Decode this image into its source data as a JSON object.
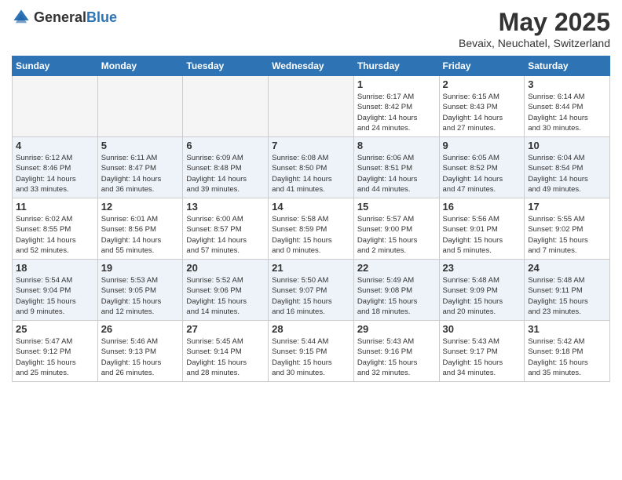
{
  "logo": {
    "general": "General",
    "blue": "Blue"
  },
  "title": "May 2025",
  "location": "Bevaix, Neuchatel, Switzerland",
  "weekdays": [
    "Sunday",
    "Monday",
    "Tuesday",
    "Wednesday",
    "Thursday",
    "Friday",
    "Saturday"
  ],
  "rows": [
    [
      {
        "day": "",
        "info": ""
      },
      {
        "day": "",
        "info": ""
      },
      {
        "day": "",
        "info": ""
      },
      {
        "day": "",
        "info": ""
      },
      {
        "day": "1",
        "info": "Sunrise: 6:17 AM\nSunset: 8:42 PM\nDaylight: 14 hours\nand 24 minutes."
      },
      {
        "day": "2",
        "info": "Sunrise: 6:15 AM\nSunset: 8:43 PM\nDaylight: 14 hours\nand 27 minutes."
      },
      {
        "day": "3",
        "info": "Sunrise: 6:14 AM\nSunset: 8:44 PM\nDaylight: 14 hours\nand 30 minutes."
      }
    ],
    [
      {
        "day": "4",
        "info": "Sunrise: 6:12 AM\nSunset: 8:46 PM\nDaylight: 14 hours\nand 33 minutes."
      },
      {
        "day": "5",
        "info": "Sunrise: 6:11 AM\nSunset: 8:47 PM\nDaylight: 14 hours\nand 36 minutes."
      },
      {
        "day": "6",
        "info": "Sunrise: 6:09 AM\nSunset: 8:48 PM\nDaylight: 14 hours\nand 39 minutes."
      },
      {
        "day": "7",
        "info": "Sunrise: 6:08 AM\nSunset: 8:50 PM\nDaylight: 14 hours\nand 41 minutes."
      },
      {
        "day": "8",
        "info": "Sunrise: 6:06 AM\nSunset: 8:51 PM\nDaylight: 14 hours\nand 44 minutes."
      },
      {
        "day": "9",
        "info": "Sunrise: 6:05 AM\nSunset: 8:52 PM\nDaylight: 14 hours\nand 47 minutes."
      },
      {
        "day": "10",
        "info": "Sunrise: 6:04 AM\nSunset: 8:54 PM\nDaylight: 14 hours\nand 49 minutes."
      }
    ],
    [
      {
        "day": "11",
        "info": "Sunrise: 6:02 AM\nSunset: 8:55 PM\nDaylight: 14 hours\nand 52 minutes."
      },
      {
        "day": "12",
        "info": "Sunrise: 6:01 AM\nSunset: 8:56 PM\nDaylight: 14 hours\nand 55 minutes."
      },
      {
        "day": "13",
        "info": "Sunrise: 6:00 AM\nSunset: 8:57 PM\nDaylight: 14 hours\nand 57 minutes."
      },
      {
        "day": "14",
        "info": "Sunrise: 5:58 AM\nSunset: 8:59 PM\nDaylight: 15 hours\nand 0 minutes."
      },
      {
        "day": "15",
        "info": "Sunrise: 5:57 AM\nSunset: 9:00 PM\nDaylight: 15 hours\nand 2 minutes."
      },
      {
        "day": "16",
        "info": "Sunrise: 5:56 AM\nSunset: 9:01 PM\nDaylight: 15 hours\nand 5 minutes."
      },
      {
        "day": "17",
        "info": "Sunrise: 5:55 AM\nSunset: 9:02 PM\nDaylight: 15 hours\nand 7 minutes."
      }
    ],
    [
      {
        "day": "18",
        "info": "Sunrise: 5:54 AM\nSunset: 9:04 PM\nDaylight: 15 hours\nand 9 minutes."
      },
      {
        "day": "19",
        "info": "Sunrise: 5:53 AM\nSunset: 9:05 PM\nDaylight: 15 hours\nand 12 minutes."
      },
      {
        "day": "20",
        "info": "Sunrise: 5:52 AM\nSunset: 9:06 PM\nDaylight: 15 hours\nand 14 minutes."
      },
      {
        "day": "21",
        "info": "Sunrise: 5:50 AM\nSunset: 9:07 PM\nDaylight: 15 hours\nand 16 minutes."
      },
      {
        "day": "22",
        "info": "Sunrise: 5:49 AM\nSunset: 9:08 PM\nDaylight: 15 hours\nand 18 minutes."
      },
      {
        "day": "23",
        "info": "Sunrise: 5:48 AM\nSunset: 9:09 PM\nDaylight: 15 hours\nand 20 minutes."
      },
      {
        "day": "24",
        "info": "Sunrise: 5:48 AM\nSunset: 9:11 PM\nDaylight: 15 hours\nand 23 minutes."
      }
    ],
    [
      {
        "day": "25",
        "info": "Sunrise: 5:47 AM\nSunset: 9:12 PM\nDaylight: 15 hours\nand 25 minutes."
      },
      {
        "day": "26",
        "info": "Sunrise: 5:46 AM\nSunset: 9:13 PM\nDaylight: 15 hours\nand 26 minutes."
      },
      {
        "day": "27",
        "info": "Sunrise: 5:45 AM\nSunset: 9:14 PM\nDaylight: 15 hours\nand 28 minutes."
      },
      {
        "day": "28",
        "info": "Sunrise: 5:44 AM\nSunset: 9:15 PM\nDaylight: 15 hours\nand 30 minutes."
      },
      {
        "day": "29",
        "info": "Sunrise: 5:43 AM\nSunset: 9:16 PM\nDaylight: 15 hours\nand 32 minutes."
      },
      {
        "day": "30",
        "info": "Sunrise: 5:43 AM\nSunset: 9:17 PM\nDaylight: 15 hours\nand 34 minutes."
      },
      {
        "day": "31",
        "info": "Sunrise: 5:42 AM\nSunset: 9:18 PM\nDaylight: 15 hours\nand 35 minutes."
      }
    ]
  ]
}
